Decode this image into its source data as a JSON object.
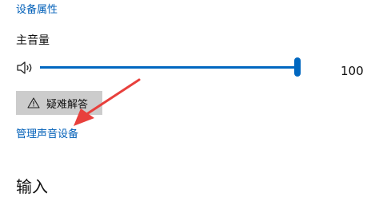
{
  "links": {
    "device_properties": "设备属性",
    "manage_sound_devices": "管理声音设备"
  },
  "volume": {
    "label": "主音量",
    "value": "100",
    "level": 1.0,
    "speaker_icon": "speaker-volume-icon"
  },
  "troubleshoot": {
    "label": "疑难解答",
    "icon": "warning-icon"
  },
  "input": {
    "heading": "输入"
  },
  "annotation": {
    "arrow_color": "#e8403c"
  },
  "colors": {
    "accent": "#0067c0",
    "link": "#005fb8",
    "button_bg": "#cccccc"
  }
}
